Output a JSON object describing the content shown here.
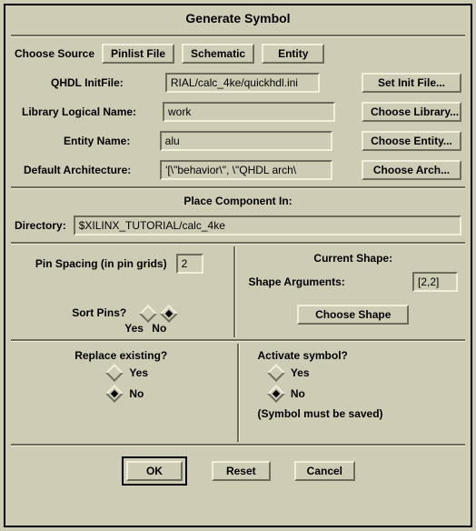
{
  "window": {
    "title": "Generate Symbol"
  },
  "source": {
    "label": "Choose Source",
    "pinlist": "Pinlist File",
    "schematic": "Schematic",
    "entity": "Entity"
  },
  "qhdl": {
    "label": "QHDL InitFile:",
    "value": "RIAL/calc_4ke/quickhdl.ini",
    "btn": "Set Init File..."
  },
  "library": {
    "label": "Library Logical Name:",
    "value": "work",
    "btn": "Choose Library..."
  },
  "entity": {
    "label": "Entity Name:",
    "value": "alu",
    "btn": "Choose Entity..."
  },
  "arch": {
    "label": "Default Architecture:",
    "value": "'[\\\"behavior\\\", \\\"QHDL arch\\",
    "btn": "Choose Arch..."
  },
  "placement": {
    "heading": "Place Component In:",
    "dir_label": "Directory:",
    "dir_value": "$XILINX_TUTORIAL/calc_4ke"
  },
  "pins": {
    "spacing_label": "Pin Spacing (in pin grids)",
    "spacing_value": "2",
    "sort_label": "Sort Pins?",
    "yes": "Yes",
    "no": "No"
  },
  "shape": {
    "heading": "Current Shape:",
    "args_label": "Shape Arguments:",
    "args_value": "[2,2]",
    "btn": "Choose Shape"
  },
  "replace": {
    "heading": "Replace existing?",
    "yes": "Yes",
    "no": "No"
  },
  "activate": {
    "heading": "Activate symbol?",
    "yes": "Yes",
    "no": "No",
    "note": "(Symbol must be saved)"
  },
  "buttons": {
    "ok": "OK",
    "reset": "Reset",
    "cancel": "Cancel"
  }
}
